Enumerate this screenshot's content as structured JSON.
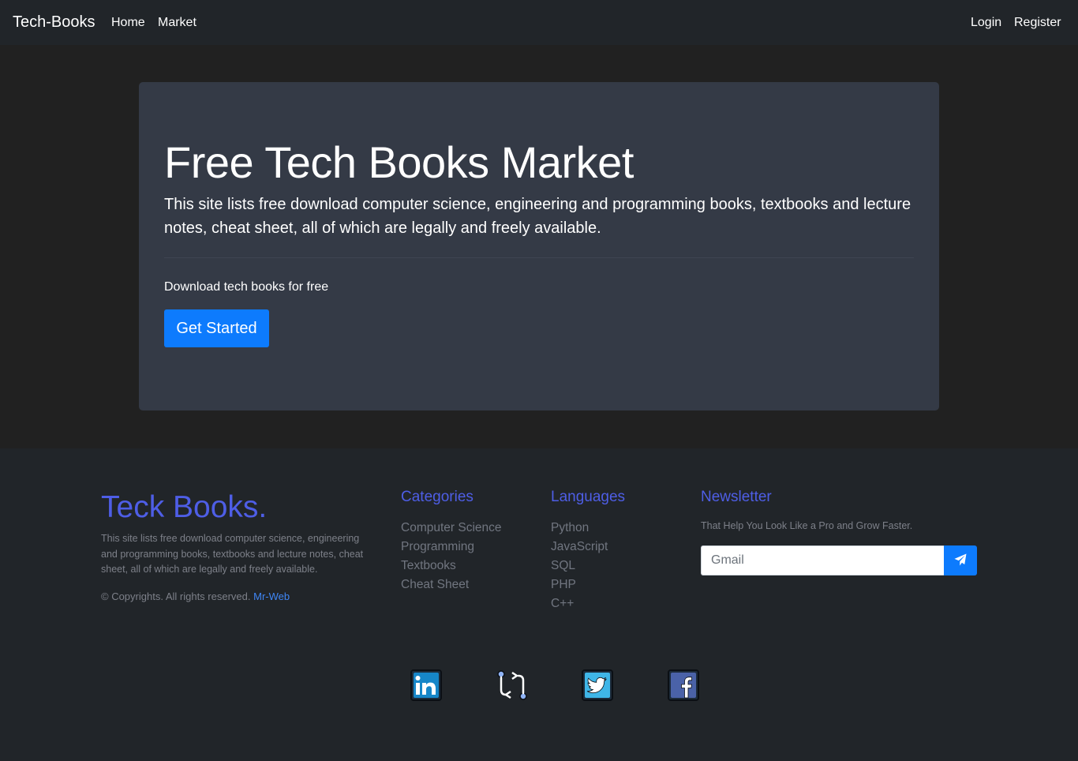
{
  "navbar": {
    "brand": "Tech-Books",
    "links": [
      "Home",
      "Market"
    ],
    "right_links": [
      "Login",
      "Register"
    ]
  },
  "jumbotron": {
    "title": "Free Tech Books Market",
    "lead": "This site lists free download computer science, engineering and programming books, textbooks and lecture notes, cheat sheet, all of which are legally and freely available.",
    "subtext": "Download tech books for free",
    "button_label": "Get Started"
  },
  "footer": {
    "brand": "Teck Books.",
    "description": "This site lists free download computer science, engineering and programming books, textbooks and lecture notes, cheat sheet, all of which are legally and freely available.",
    "copyright_prefix": "© Copyrights. All rights reserved.",
    "copyright_link": "Mr-Web",
    "categories": {
      "heading": "Categories",
      "items": [
        "Computer Science",
        "Programming",
        "Textbooks",
        "Cheat Sheet"
      ]
    },
    "languages": {
      "heading": "Languages",
      "items": [
        "Python",
        "JavaScript",
        "SQL",
        "PHP",
        "C++"
      ]
    },
    "newsletter": {
      "heading": "Newsletter",
      "tagline": "That Help You Look Like a Pro and Grow Faster.",
      "input_placeholder": "Gmail",
      "send_icon": "paper-plane-icon"
    },
    "social": [
      "linkedin-icon",
      "git-pull-request-icon",
      "twitter-icon",
      "facebook-icon"
    ]
  },
  "colors": {
    "page_bg": "#212121",
    "nav_bg": "#212529",
    "jumbotron_bg": "#343a46",
    "primary": "#0d7bfd",
    "footer_accent": "#4e5ee6",
    "footer_text": "#7d8089"
  }
}
